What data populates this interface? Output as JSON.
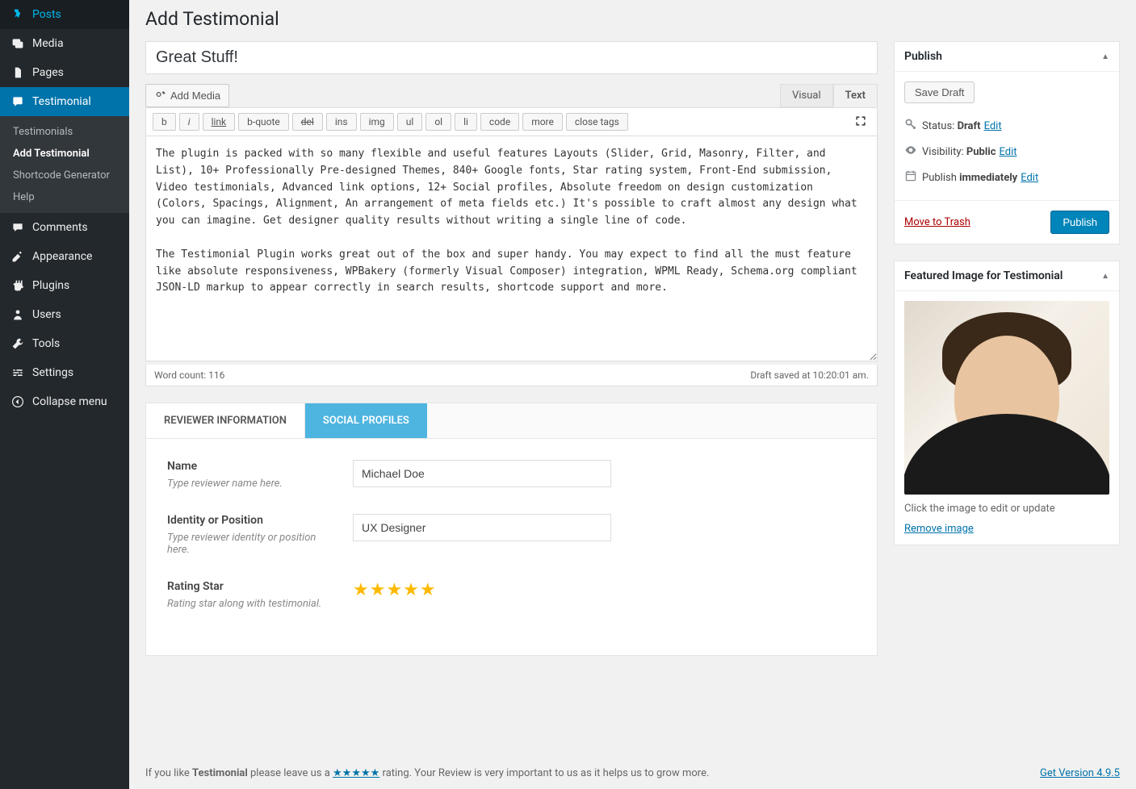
{
  "sidebar": {
    "items": [
      {
        "icon": "pin",
        "label": "Posts"
      },
      {
        "icon": "media",
        "label": "Media"
      },
      {
        "icon": "page",
        "label": "Pages"
      },
      {
        "icon": "testimonial",
        "label": "Testimonial",
        "current": true
      },
      {
        "icon": "comment",
        "label": "Comments"
      },
      {
        "icon": "appearance",
        "label": "Appearance"
      },
      {
        "icon": "plugin",
        "label": "Plugins"
      },
      {
        "icon": "users",
        "label": "Users"
      },
      {
        "icon": "tools",
        "label": "Tools"
      },
      {
        "icon": "settings",
        "label": "Settings"
      },
      {
        "icon": "collapse",
        "label": "Collapse menu"
      }
    ],
    "submenu": [
      {
        "label": "Testimonials"
      },
      {
        "label": "Add Testimonial",
        "current": true
      },
      {
        "label": "Shortcode Generator"
      },
      {
        "label": "Help"
      }
    ]
  },
  "page": {
    "title": "Add Testimonial"
  },
  "post": {
    "title": "Great Stuff!",
    "content": "The plugin is packed with so many flexible and useful features Layouts (Slider, Grid, Masonry, Filter, and List), 10+ Professionally Pre-designed Themes, 840+ Google fonts, Star rating system, Front-End submission, Video testimonials, Advanced link options, 12+ Social profiles, Absolute freedom on design customization (Colors, Spacings, Alignment, An arrangement of meta fields etc.) It's possible to craft almost any design what you can imagine. Get designer quality results without writing a single line of code.\n\nThe Testimonial Plugin works great out of the box and super handy. You may expect to find all the must feature like absolute responsiveness, WPBakery (formerly Visual Composer) integration, WPML Ready, Schema.org compliant JSON-LD markup to appear correctly in search results, shortcode support and more.",
    "word_count": "Word count: 116",
    "saved_status": "Draft saved at 10:20:01 am."
  },
  "media": {
    "add_media": "Add Media"
  },
  "editor_tabs": {
    "visual": "Visual",
    "text": "Text"
  },
  "quicktags": [
    "b",
    "i",
    "link",
    "b-quote",
    "del",
    "ins",
    "img",
    "ul",
    "ol",
    "li",
    "code",
    "more",
    "close tags"
  ],
  "meta_tabs": {
    "reviewer": "REVIEWER INFORMATION",
    "social": "SOCIAL PROFILES"
  },
  "fields": {
    "name": {
      "label": "Name",
      "desc": "Type reviewer name here.",
      "value": "Michael Doe"
    },
    "identity": {
      "label": "Identity or Position",
      "desc": "Type reviewer identity or position here.",
      "value": "UX Designer"
    },
    "rating": {
      "label": "Rating Star",
      "desc": "Rating star along with testimonial.",
      "stars": "★★★★★"
    }
  },
  "publish": {
    "heading": "Publish",
    "save_draft": "Save Draft",
    "status_label": "Status:",
    "status_value": "Draft",
    "status_edit": "Edit",
    "visibility_label": "Visibility:",
    "visibility_value": "Public",
    "visibility_edit": "Edit",
    "schedule_label": "Publish",
    "schedule_value": "immediately",
    "schedule_edit": "Edit",
    "trash": "Move to Trash",
    "publish_btn": "Publish"
  },
  "featured": {
    "heading": "Featured Image for Testimonial",
    "caption": "Click the image to edit or update",
    "remove": "Remove image"
  },
  "footer": {
    "prefix": "If you like ",
    "product": "Testimonial",
    "mid1": " please leave us a ",
    "stars": "★★★★★",
    "mid2": " rating. Your Review is very important to us as it helps us to grow more.",
    "version": "Get Version 4.9.5"
  }
}
